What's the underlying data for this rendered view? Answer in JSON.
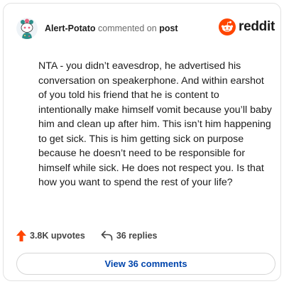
{
  "header": {
    "username": "Alert-Potato",
    "action_text": "commented on",
    "target_text": "post",
    "brand_word": "reddit"
  },
  "comment": {
    "text": "NTA - you didn’t eavesdrop, he advertised his conversation on speakerphone. And within earshot of you told his friend that he is content to intentionally make himself vomit because you’ll baby him and clean up after him. This isn’t him happening to get sick. This is him getting sick on purpose because he doesn’t need to be responsible for himself while sick. He does not respect you. Is that how you want to spend the rest of your life?"
  },
  "actions": {
    "upvotes": "3.8K upvotes",
    "replies": "36 replies"
  },
  "footer": {
    "view_comments": "View 36 comments"
  },
  "colors": {
    "brand": "#ff4500",
    "link": "#0045ac",
    "upvote": "#ff4500"
  },
  "icons": {
    "avatar": "snoo-avatar-icon",
    "logo": "reddit-logo-icon",
    "upvote": "upvote-arrow-icon",
    "reply": "reply-arrow-icon"
  }
}
